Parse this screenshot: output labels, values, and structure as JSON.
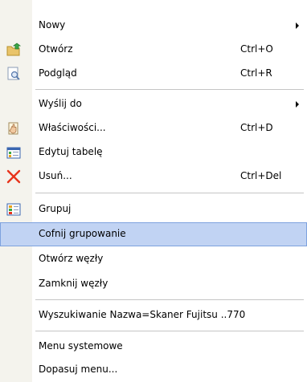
{
  "menu": {
    "items": [
      {
        "label": "Nowy",
        "shortcut": "",
        "submenu": true,
        "icon": null
      },
      {
        "label": "Otwórz",
        "shortcut": "Ctrl+O",
        "submenu": false,
        "icon": "open-folder-icon"
      },
      {
        "label": "Podgląd",
        "shortcut": "Ctrl+R",
        "submenu": false,
        "icon": "preview-magnifier-icon"
      },
      {
        "label": "Wyślij do",
        "shortcut": "",
        "submenu": true,
        "icon": null
      },
      {
        "label": "Właściwości...",
        "shortcut": "Ctrl+D",
        "submenu": false,
        "icon": "properties-hand-icon"
      },
      {
        "label": "Edytuj tabelę",
        "shortcut": "",
        "submenu": false,
        "icon": "edit-table-icon"
      },
      {
        "label": "Usuń...",
        "shortcut": "Ctrl+Del",
        "submenu": false,
        "icon": "delete-x-icon"
      },
      {
        "label": "Grupuj",
        "shortcut": "",
        "submenu": false,
        "icon": "group-icon"
      },
      {
        "label": "Cofnij grupowanie",
        "shortcut": "",
        "submenu": false,
        "icon": null
      },
      {
        "label": "Otwórz węzły",
        "shortcut": "",
        "submenu": false,
        "icon": null
      },
      {
        "label": "Zamknij węzły",
        "shortcut": "",
        "submenu": false,
        "icon": null
      },
      {
        "label": "Wyszukiwanie Nazwa=Skaner Fujitsu ..770",
        "shortcut": "",
        "submenu": false,
        "icon": null
      },
      {
        "label": "Menu systemowe",
        "shortcut": "",
        "submenu": false,
        "icon": null
      },
      {
        "label": "Dopasuj menu...",
        "shortcut": "",
        "submenu": false,
        "icon": null
      }
    ],
    "highlighted_item": "Cofnij grupowanie",
    "colors": {
      "gutter": "#f4f3ed",
      "highlight": "#c1d3f3",
      "highlight_border": "#7ea2de",
      "separator": "#c5c5c5",
      "delete_icon": "#e8341c"
    }
  }
}
